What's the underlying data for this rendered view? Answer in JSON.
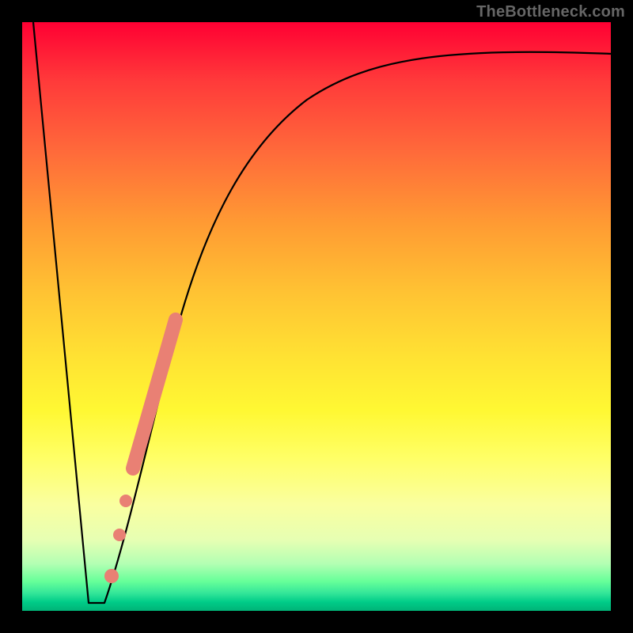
{
  "watermark": {
    "text": "TheBottleneck.com"
  },
  "chart_data": {
    "type": "line",
    "title": "",
    "xlabel": "",
    "ylabel": "",
    "xlim": [
      0,
      100
    ],
    "ylim": [
      0,
      100
    ],
    "grid": false,
    "series": [
      {
        "name": "left-descent",
        "x": [
          0,
          10,
          11,
          14
        ],
        "y": [
          100,
          1,
          1,
          1
        ]
      },
      {
        "name": "rising-asymptote",
        "x": [
          14,
          16,
          18,
          20,
          24,
          28,
          34,
          42,
          52,
          64,
          78,
          90,
          100
        ],
        "y": [
          1,
          9,
          18,
          27,
          40,
          51,
          62,
          72,
          80,
          86,
          90,
          92.5,
          94
        ]
      }
    ],
    "highlight_segment": {
      "name": "salmon-band",
      "x_range": [
        19,
        27
      ],
      "y_range": [
        24,
        50
      ]
    },
    "highlight_dots": {
      "name": "salmon-dots",
      "points": [
        {
          "x": 17.0,
          "y": 15
        },
        {
          "x": 16.0,
          "y": 10
        },
        {
          "x": 15.0,
          "y": 5
        }
      ]
    }
  }
}
